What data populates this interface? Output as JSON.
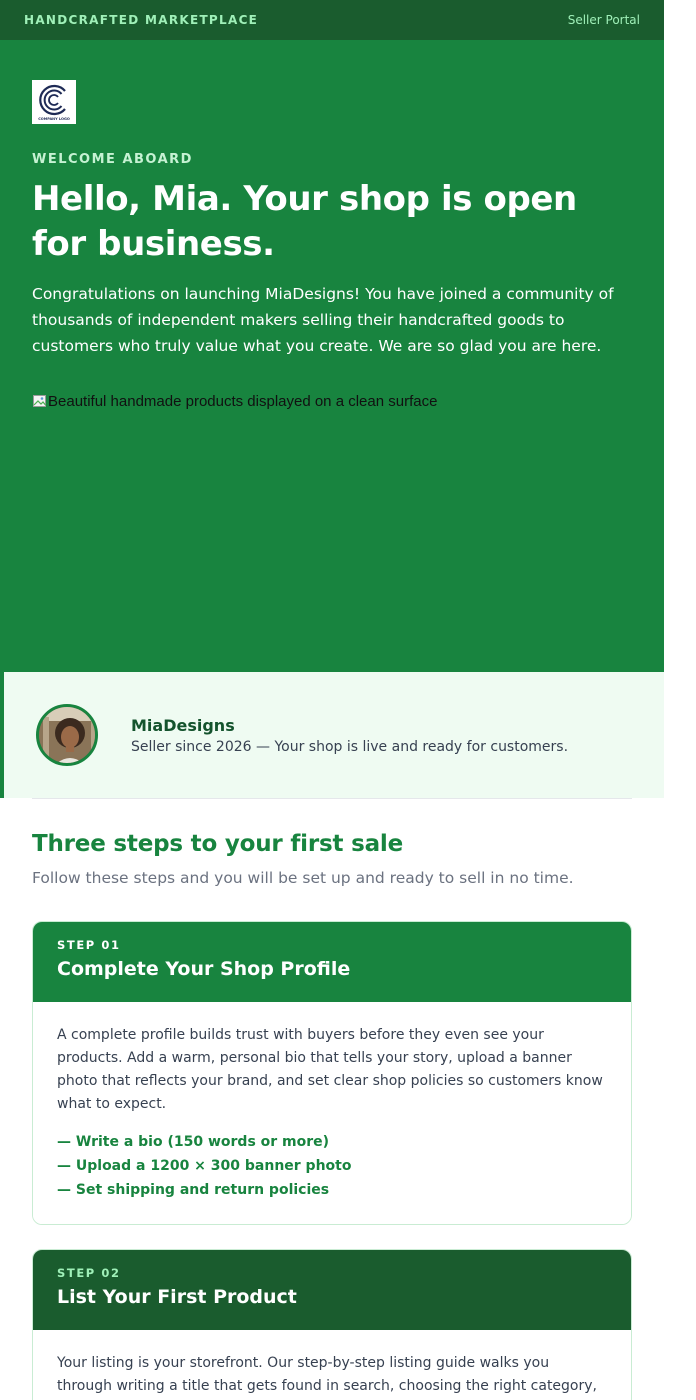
{
  "header": {
    "brand": "HANDCRAFTED MARKETPLACE",
    "portal_link": "Seller Portal"
  },
  "hero": {
    "logo_alt": "COMPANY LOGO",
    "eyebrow": "WELCOME ABOARD",
    "title": "Hello, Mia. Your shop is open for business.",
    "intro": "Congratulations on launching MiaDesigns! You have joined a community of thousands of independent makers selling their handcrafted goods to customers who truly value what you create. We are so glad you are here.",
    "image_alt": "Beautiful handmade products displayed on a clean surface"
  },
  "seller": {
    "name": "MiaDesigns",
    "since": "Seller since 2026 — Your shop is live and ready for customers."
  },
  "steps_section": {
    "heading": "Three steps to your first sale",
    "subheading": "Follow these steps and you will be set up and ready to sell in no time.",
    "steps": [
      {
        "number": "STEP 01",
        "title": "Complete Your Shop Profile",
        "body": "A complete profile builds trust with buyers before they even see your products. Add a warm, personal bio that tells your story, upload a banner photo that reflects your brand, and set clear shop policies so customers know what to expect.",
        "items": [
          "— Write a bio (150 words or more)",
          "— Upload a 1200 × 300 banner photo",
          "— Set shipping and return policies"
        ]
      },
      {
        "number": "STEP 02",
        "title": "List Your First Product",
        "body": "Your listing is your storefront. Our step-by-step listing guide walks you through writing a title that gets found in search, choosing the right category, setting a competitive price, and uploading photos that make buyers stop scrolling."
      }
    ]
  },
  "colors": {
    "primary_green": "#18843f",
    "dark_green": "#1a5c2e",
    "mint": "#9ff0b8",
    "light_bg": "#effbf2"
  }
}
